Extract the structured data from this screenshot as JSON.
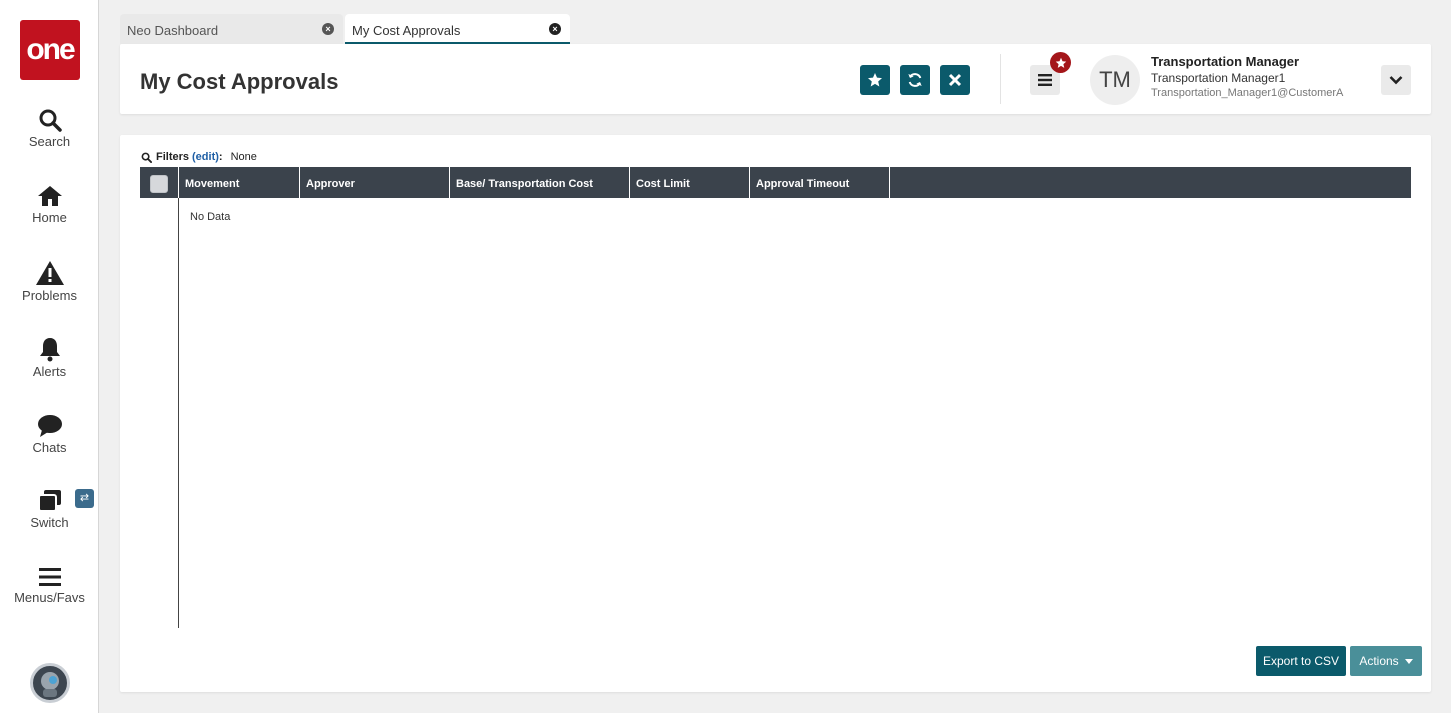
{
  "brand": {
    "logo_text": "one",
    "logo_color": "#c1121f"
  },
  "sidebar": {
    "items": [
      {
        "label": "Search",
        "icon": "search-icon"
      },
      {
        "label": "Home",
        "icon": "home-icon"
      },
      {
        "label": "Problems",
        "icon": "warning-icon"
      },
      {
        "label": "Alerts",
        "icon": "bell-icon"
      },
      {
        "label": "Chats",
        "icon": "chat-icon"
      },
      {
        "label": "Switch",
        "icon": "switch-icon",
        "badge": "⇄"
      },
      {
        "label": "Menus/Favs",
        "icon": "menu-icon"
      }
    ],
    "bottom_avatar": "assistant-avatar-icon"
  },
  "tabs": [
    {
      "label": "Neo Dashboard",
      "active": false
    },
    {
      "label": "My Cost Approvals",
      "active": true
    }
  ],
  "header": {
    "title": "My Cost Approvals",
    "buttons": [
      "star-icon",
      "refresh-icon",
      "close-icon"
    ],
    "accent_color": "#0b5a6b"
  },
  "user": {
    "initials": "TM",
    "name": "Transportation Manager",
    "role": "Transportation Manager1",
    "email": "Transportation_Manager1@CustomerA"
  },
  "filters": {
    "label": "Filters",
    "edit_label": "(edit)",
    "value": "None"
  },
  "grid": {
    "columns": [
      "Movement",
      "Approver",
      "Base/ Transportation Cost",
      "Cost Limit",
      "Approval Timeout"
    ],
    "empty_text": "No Data",
    "header_color": "#3b434c"
  },
  "footer": {
    "export_label": "Export to CSV",
    "actions_label": "Actions"
  }
}
